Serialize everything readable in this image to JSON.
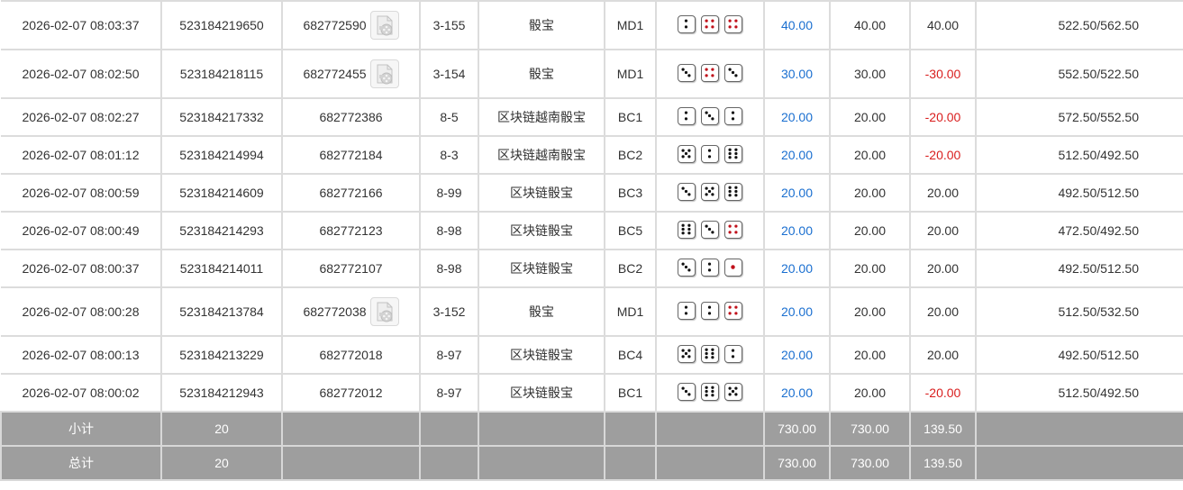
{
  "colors": {
    "positive_text": "#1a6fd0",
    "negative_text": "#d91e1e",
    "summary_bg": "#9e9e9e",
    "pip_black": "#111111",
    "pip_red": "#c0101a"
  },
  "rows": [
    {
      "time": "2026-02-07 08:03:37",
      "bet_id": "523184219650",
      "table_id": "682772590",
      "has_replay": true,
      "round": "3-155",
      "game": "骰宝",
      "code": "MD1",
      "dice": [
        2,
        4,
        4
      ],
      "bet": "40.00",
      "valid": "40.00",
      "winloss": "40.00",
      "winloss_sign": "pos",
      "balance": "522.50/562.50"
    },
    {
      "time": "2026-02-07 08:02:50",
      "bet_id": "523184218115",
      "table_id": "682772455",
      "has_replay": true,
      "round": "3-154",
      "game": "骰宝",
      "code": "MD1",
      "dice": [
        3,
        4,
        3
      ],
      "bet": "30.00",
      "valid": "30.00",
      "winloss": "-30.00",
      "winloss_sign": "neg",
      "balance": "552.50/522.50"
    },
    {
      "time": "2026-02-07 08:02:27",
      "bet_id": "523184217332",
      "table_id": "682772386",
      "has_replay": false,
      "round": "8-5",
      "game": "区块链越南骰宝",
      "code": "BC1",
      "dice": [
        2,
        3,
        2
      ],
      "bet": "20.00",
      "valid": "20.00",
      "winloss": "-20.00",
      "winloss_sign": "neg",
      "balance": "572.50/552.50"
    },
    {
      "time": "2026-02-07 08:01:12",
      "bet_id": "523184214994",
      "table_id": "682772184",
      "has_replay": false,
      "round": "8-3",
      "game": "区块链越南骰宝",
      "code": "BC2",
      "dice": [
        5,
        2,
        6
      ],
      "bet": "20.00",
      "valid": "20.00",
      "winloss": "-20.00",
      "winloss_sign": "neg",
      "balance": "512.50/492.50"
    },
    {
      "time": "2026-02-07 08:00:59",
      "bet_id": "523184214609",
      "table_id": "682772166",
      "has_replay": false,
      "round": "8-99",
      "game": "区块链骰宝",
      "code": "BC3",
      "dice": [
        3,
        5,
        6
      ],
      "bet": "20.00",
      "valid": "20.00",
      "winloss": "20.00",
      "winloss_sign": "zero",
      "balance": "492.50/512.50"
    },
    {
      "time": "2026-02-07 08:00:49",
      "bet_id": "523184214293",
      "table_id": "682772123",
      "has_replay": false,
      "round": "8-98",
      "game": "区块链骰宝",
      "code": "BC5",
      "dice": [
        6,
        3,
        4
      ],
      "bet": "20.00",
      "valid": "20.00",
      "winloss": "20.00",
      "winloss_sign": "zero",
      "balance": "472.50/492.50"
    },
    {
      "time": "2026-02-07 08:00:37",
      "bet_id": "523184214011",
      "table_id": "682772107",
      "has_replay": false,
      "round": "8-98",
      "game": "区块链骰宝",
      "code": "BC2",
      "dice": [
        3,
        2,
        1
      ],
      "bet": "20.00",
      "valid": "20.00",
      "winloss": "20.00",
      "winloss_sign": "zero",
      "balance": "492.50/512.50"
    },
    {
      "time": "2026-02-07 08:00:28",
      "bet_id": "523184213784",
      "table_id": "682772038",
      "has_replay": true,
      "round": "3-152",
      "game": "骰宝",
      "code": "MD1",
      "dice": [
        2,
        2,
        4
      ],
      "bet": "20.00",
      "valid": "20.00",
      "winloss": "20.00",
      "winloss_sign": "zero",
      "balance": "512.50/532.50"
    },
    {
      "time": "2026-02-07 08:00:13",
      "bet_id": "523184213229",
      "table_id": "682772018",
      "has_replay": false,
      "round": "8-97",
      "game": "区块链骰宝",
      "code": "BC4",
      "dice": [
        5,
        6,
        2
      ],
      "bet": "20.00",
      "valid": "20.00",
      "winloss": "20.00",
      "winloss_sign": "zero",
      "balance": "492.50/512.50"
    },
    {
      "time": "2026-02-07 08:00:02",
      "bet_id": "523184212943",
      "table_id": "682772012",
      "has_replay": false,
      "round": "8-97",
      "game": "区块链骰宝",
      "code": "BC1",
      "dice": [
        3,
        6,
        5
      ],
      "bet": "20.00",
      "valid": "20.00",
      "winloss": "-20.00",
      "winloss_sign": "neg",
      "balance": "512.50/492.50"
    }
  ],
  "subtotal": {
    "label": "小计",
    "count": "20",
    "bet": "730.00",
    "valid": "730.00",
    "winloss": "139.50"
  },
  "total": {
    "label": "总计",
    "count": "20",
    "bet": "730.00",
    "valid": "730.00",
    "winloss": "139.50"
  },
  "icons": {
    "replay": "video-replay-icon",
    "die": "die-icon"
  }
}
